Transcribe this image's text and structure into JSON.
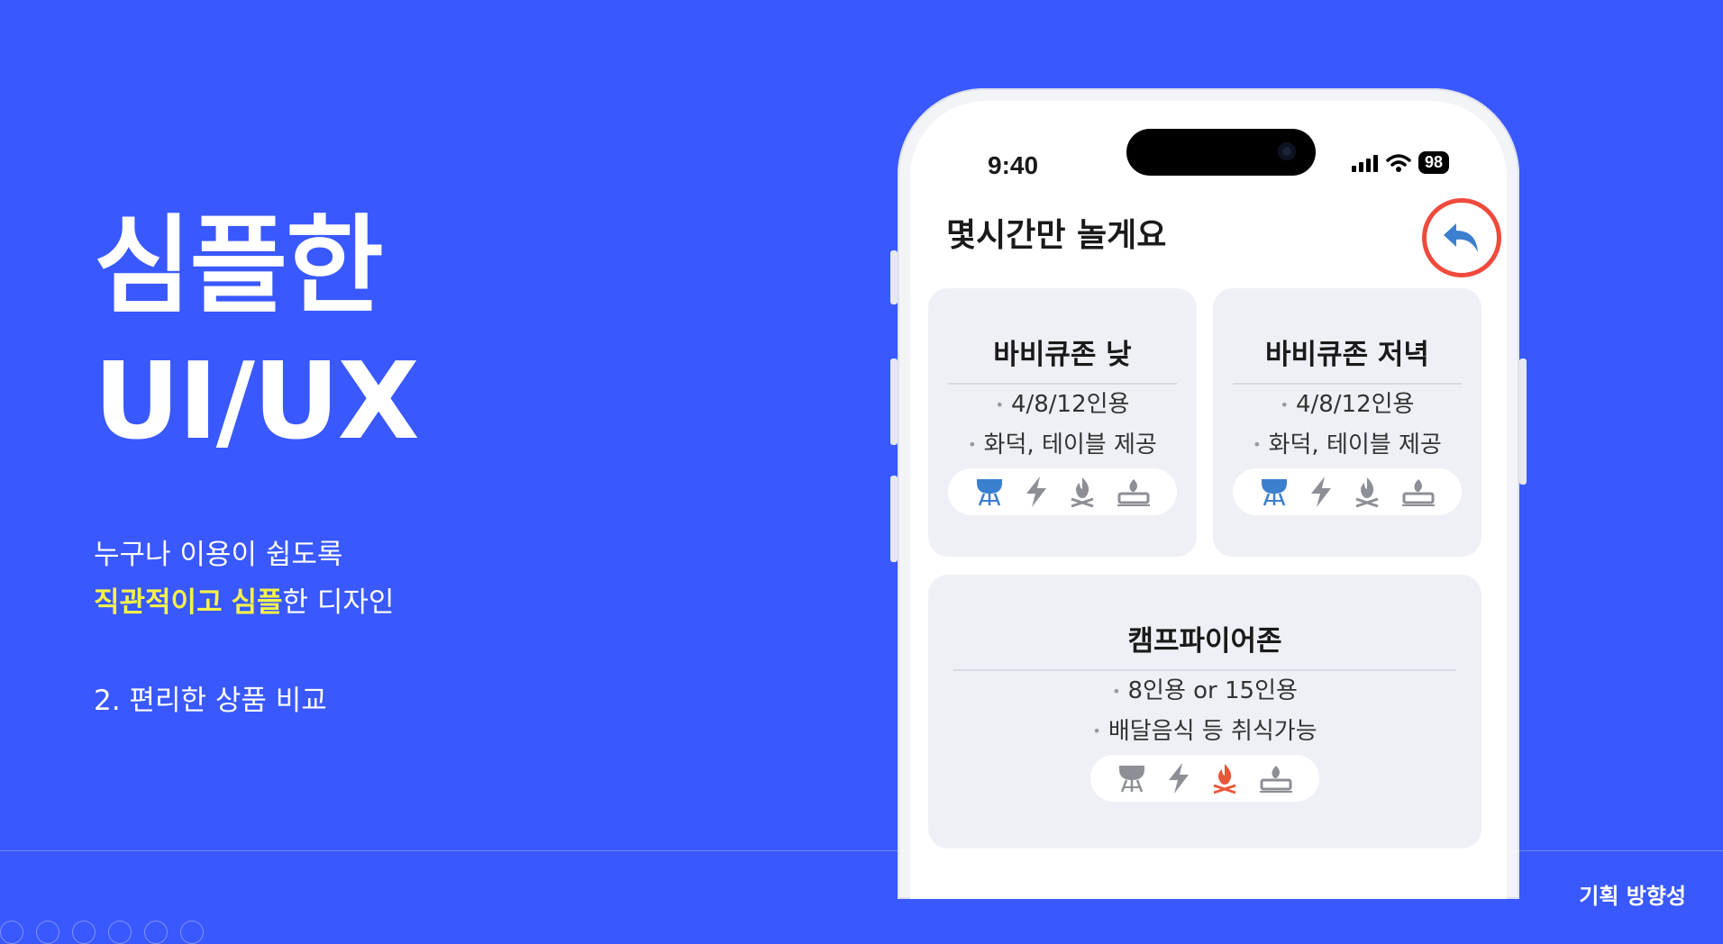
{
  "left": {
    "headline_line1": "심플한",
    "headline_line2": "UI/UX",
    "desc_line1": "누구나 이용이 쉽도록",
    "desc_hl1": "직관적이고",
    "desc_space": " ",
    "desc_hl2": "심플",
    "desc_rest": "한 디자인",
    "point": "2. 편리한 상품 비교"
  },
  "footer": {
    "tag": "기획 방향성"
  },
  "phone": {
    "status": {
      "time": "9:40",
      "battery": "98"
    },
    "title": "몇시간만 놀게요",
    "cards": [
      {
        "title": "바비큐존 낮",
        "features": [
          "4/8/12인용",
          "화덕, 테이블 제공"
        ]
      },
      {
        "title": "바비큐존 저녁",
        "features": [
          "4/8/12인용",
          "화덕, 테이블 제공"
        ]
      },
      {
        "title": "캠프파이어존",
        "features": [
          "8인용 or 15인용",
          "배달음식 등 취식가능"
        ]
      }
    ],
    "icon_names": [
      "grill-icon",
      "lightning-icon",
      "campfire-icon",
      "stove-icon"
    ],
    "colors": {
      "grill_active": "#3b7fcf",
      "fire_active": "#e8573a",
      "icon_inactive": "#8d8f96",
      "back": "#3b7fcf",
      "highlight_ring": "#ef4a3c"
    }
  }
}
